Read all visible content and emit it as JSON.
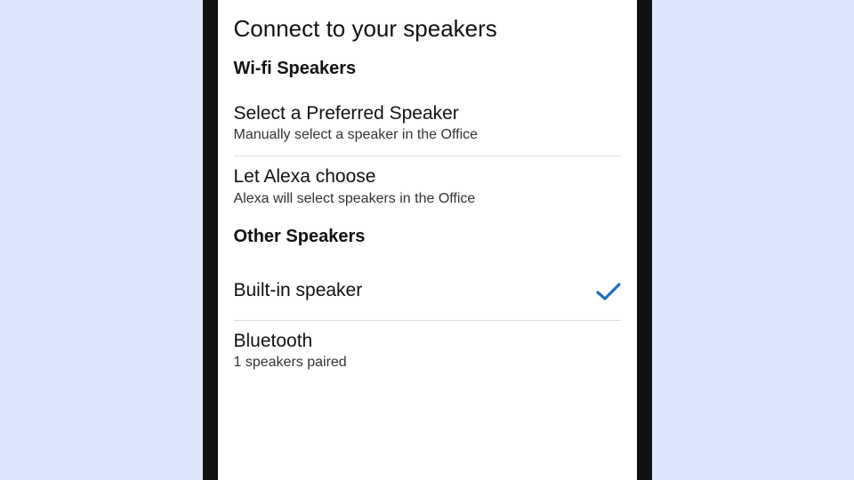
{
  "title": "Connect to your speakers",
  "sections": {
    "wifi": {
      "label": "Wi-fi Speakers",
      "rows": [
        {
          "title": "Select a Preferred Speaker",
          "sub": "Manually select a speaker in the Office"
        },
        {
          "title": "Let Alexa choose",
          "sub": "Alexa will select speakers in the Office"
        }
      ]
    },
    "other": {
      "label": "Other Speakers",
      "rows": [
        {
          "title": "Built-in speaker",
          "sub": "",
          "selected": true
        },
        {
          "title": "Bluetooth",
          "sub": "1 speakers paired"
        }
      ]
    }
  }
}
